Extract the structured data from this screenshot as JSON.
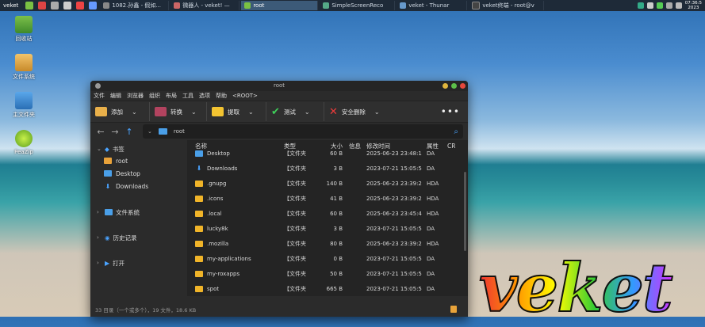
{
  "taskbar": {
    "start_label": "veket",
    "tasks": [
      {
        "label": "1082.孙鑫 - 假如...",
        "active": false
      },
      {
        "label": "微器人 - veket! —",
        "active": false
      },
      {
        "label": "root",
        "active": true
      },
      {
        "label": "SimpleScreenReco",
        "active": false
      },
      {
        "label": "veket - Thunar",
        "active": false
      },
      {
        "label": "veket终端 - root@v",
        "active": false
      }
    ],
    "clock_line1": "07:36:5",
    "clock_line2": "2023"
  },
  "desktop": {
    "icons": [
      {
        "label": "回收站"
      },
      {
        "label": "文件系统"
      },
      {
        "label": "主文件夹"
      },
      {
        "label": "PeaZip"
      }
    ],
    "logo_text": "veket"
  },
  "window": {
    "title": "root",
    "menu": [
      "文件",
      "编辑",
      "浏览器",
      "组织",
      "布局",
      "工具",
      "选项",
      "帮助",
      "<ROOT>"
    ],
    "toolbar": {
      "add": "添加",
      "convert": "转换",
      "extract": "提取",
      "test": "测试",
      "secure_delete": "安全删除",
      "more": "•••"
    },
    "path": "root",
    "sidebar": {
      "bookmarks_label": "书签",
      "bookmarks": [
        "root",
        "Desktop",
        "Downloads"
      ],
      "filesystem_label": "文件系统",
      "history_label": "历史记录",
      "open_label": "打开"
    },
    "columns": {
      "name": "名称",
      "type": "类型",
      "size": "大小",
      "info": "信息",
      "modified": "修改时间",
      "attr": "属性",
      "cr": "CR"
    },
    "files": [
      {
        "name": "Desktop",
        "type": "【文件夹",
        "size": "60 B",
        "modified": "2025-06-23 23:48:1",
        "attr": "DA",
        "icon": "blue"
      },
      {
        "name": "Downloads",
        "type": "【文件夹",
        "size": "3 B",
        "modified": "2023-07-21 15:05:5",
        "attr": "DA",
        "icon": "dl"
      },
      {
        "name": ".gnupg",
        "type": "【文件夹",
        "size": "140 B",
        "modified": "2025-06-23 23:39:2",
        "attr": "HDA",
        "icon": "folder"
      },
      {
        "name": ".icons",
        "type": "【文件夹",
        "size": "41 B",
        "modified": "2025-06-23 23:39:2",
        "attr": "HDA",
        "icon": "folder"
      },
      {
        "name": ".local",
        "type": "【文件夹",
        "size": "60 B",
        "modified": "2025-06-23 23:45:4",
        "attr": "HDA",
        "icon": "folder"
      },
      {
        "name": "lucky8k",
        "type": "【文件夹",
        "size": "3 B",
        "modified": "2023-07-21 15:05:5",
        "attr": "DA",
        "icon": "folder"
      },
      {
        "name": ".mozilla",
        "type": "【文件夹",
        "size": "80 B",
        "modified": "2025-06-23 23:39:2",
        "attr": "HDA",
        "icon": "folder"
      },
      {
        "name": "my-applications",
        "type": "【文件夹",
        "size": "0 B",
        "modified": "2023-07-21 15:05:5",
        "attr": "DA",
        "icon": "folder"
      },
      {
        "name": "my-roxapps",
        "type": "【文件夹",
        "size": "50 B",
        "modified": "2023-07-21 15:05:5",
        "attr": "DA",
        "icon": "folder"
      },
      {
        "name": "spot",
        "type": "【文件夹",
        "size": "665 B",
        "modified": "2023-07-21 15:05:5",
        "attr": "DA",
        "icon": "folder"
      }
    ],
    "status": "33 目录（一个或多个），19 文件，18.6 KB"
  },
  "colors": {
    "accent": "#4aa3ff",
    "folder": "#f0b429"
  }
}
